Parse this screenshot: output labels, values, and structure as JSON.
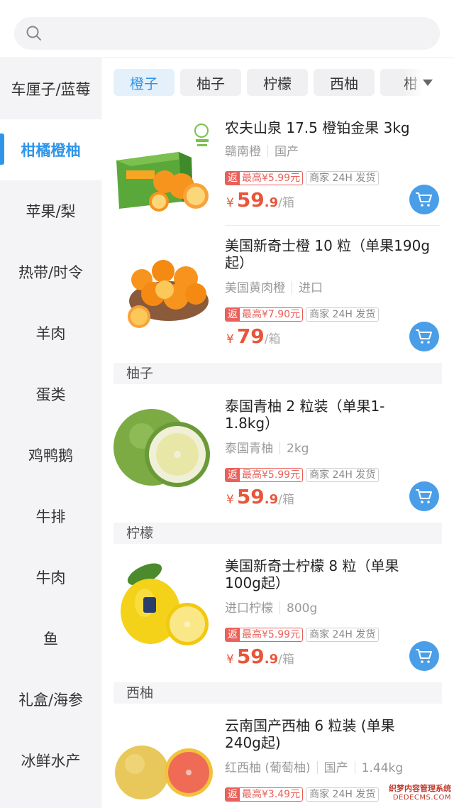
{
  "search": {
    "placeholder": ""
  },
  "sidebar": {
    "items": [
      {
        "label": "车厘子/蓝莓"
      },
      {
        "label": "柑橘橙柚"
      },
      {
        "label": "苹果/梨"
      },
      {
        "label": "热带/时令"
      },
      {
        "label": "羊肉"
      },
      {
        "label": "蛋类"
      },
      {
        "label": "鸡鸭鹅"
      },
      {
        "label": "牛排"
      },
      {
        "label": "牛肉"
      },
      {
        "label": "鱼"
      },
      {
        "label": "礼盒/海参"
      },
      {
        "label": "冰鲜水产"
      }
    ],
    "active_index": 1
  },
  "tabs": [
    {
      "label": "橙子"
    },
    {
      "label": "柚子"
    },
    {
      "label": "柠檬"
    },
    {
      "label": "西柚"
    },
    {
      "label": "柑"
    }
  ],
  "sections": {
    "youzi": "柚子",
    "ningmeng": "柠檬",
    "xiyou": "西柚"
  },
  "products": [
    {
      "title": "农夫山泉 17.5 橙铂金果 3kg",
      "tags": [
        "赣南橙",
        "国产"
      ],
      "rebate_prefix": "返",
      "rebate_text": "最高¥5.99元",
      "ship": "商家 24H 发货",
      "currency": "¥",
      "price_int": "59",
      "price_dec": ".9",
      "unit": "/箱"
    },
    {
      "title": "美国新奇士橙 10 粒（单果190g起）",
      "tags": [
        "美国黄肉橙",
        "进口"
      ],
      "rebate_prefix": "返",
      "rebate_text": "最高¥7.90元",
      "ship": "商家 24H 发货",
      "currency": "¥",
      "price_int": "79",
      "price_dec": "",
      "unit": "/箱"
    },
    {
      "title": "泰国青柚 2 粒装（单果1-1.8kg）",
      "tags": [
        "泰国青柚",
        "2kg"
      ],
      "rebate_prefix": "返",
      "rebate_text": "最高¥5.99元",
      "ship": "商家 24H 发货",
      "currency": "¥",
      "price_int": "59",
      "price_dec": ".9",
      "unit": "/箱"
    },
    {
      "title": "美国新奇士柠檬 8 粒（单果100g起）",
      "tags": [
        "进口柠檬",
        "800g"
      ],
      "rebate_prefix": "返",
      "rebate_text": "最高¥5.99元",
      "ship": "商家 24H 发货",
      "currency": "¥",
      "price_int": "59",
      "price_dec": ".9",
      "unit": "/箱"
    },
    {
      "title": "云南国产西柚 6 粒装 (单果240g起)",
      "tags": [
        "红西柚 (葡萄柚)",
        "国产",
        "1.44kg"
      ],
      "rebate_prefix": "返",
      "rebate_text": "最高¥3.49元",
      "ship": "商家 24H 发货"
    }
  ],
  "watermark": {
    "line1": "织梦内容管理系统",
    "line2": "DEDECMS.COM"
  },
  "colors": {
    "accent": "#2f95e8",
    "price": "#e8563a",
    "cart": "#4a9ee8"
  }
}
